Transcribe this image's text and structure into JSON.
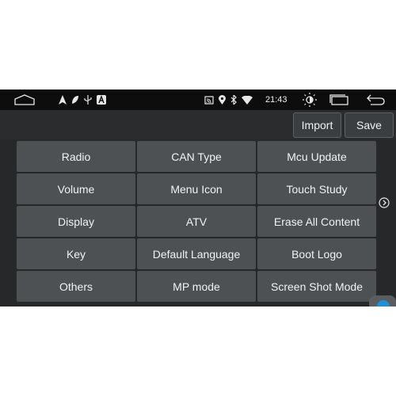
{
  "status_bar": {
    "time": "21:43",
    "left_icons": [
      "home-icon",
      "navigation-icon",
      "leaf-icon",
      "usb-icon",
      "autostart-a-icon"
    ],
    "right_icons": [
      "cast-icon",
      "location-icon",
      "bluetooth-icon",
      "wifi-icon"
    ],
    "nav_icons": [
      "brightness-icon",
      "recent-apps-icon",
      "back-icon"
    ]
  },
  "toolbar": {
    "import_label": "Import",
    "save_label": "Save"
  },
  "grid": {
    "items": [
      {
        "label": "Radio"
      },
      {
        "label": "CAN Type"
      },
      {
        "label": "Mcu Update"
      },
      {
        "label": "Volume"
      },
      {
        "label": "Menu Icon"
      },
      {
        "label": "Touch Study"
      },
      {
        "label": "Display"
      },
      {
        "label": "ATV"
      },
      {
        "label": "Erase All Content"
      },
      {
        "label": "Key"
      },
      {
        "label": "Default Language"
      },
      {
        "label": "Boot Logo"
      },
      {
        "label": "Others"
      },
      {
        "label": "MP mode"
      },
      {
        "label": "Screen Shot Mode"
      }
    ]
  },
  "colors": {
    "status_bar_bg": "#0d0d0d",
    "toolbar_bg": "#2a2c2e",
    "content_bg": "#26282a",
    "button_bg": "#4d5154",
    "accent_badge": "#1f8fd6"
  }
}
